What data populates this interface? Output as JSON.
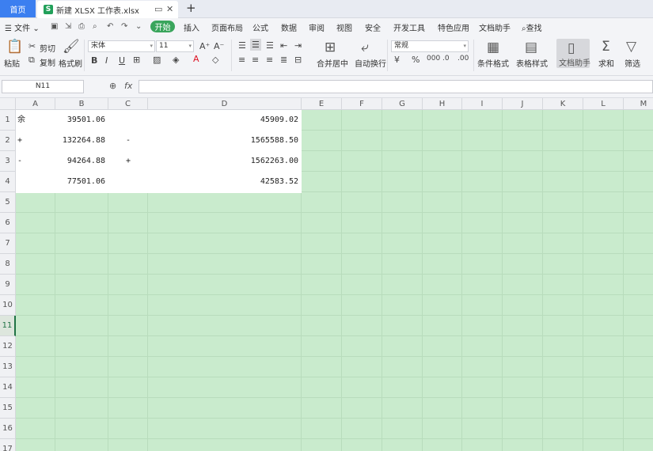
{
  "tabs": {
    "home": "首页",
    "file": "新建 XLSX 工作表.xlsx",
    "new_tab": "+"
  },
  "menu": {
    "file": "文件",
    "items": [
      "开始",
      "插入",
      "页面布局",
      "公式",
      "数据",
      "审阅",
      "视图",
      "安全",
      "开发工具",
      "特色应用",
      "文档助手",
      "查找"
    ]
  },
  "ribbon": {
    "paste": "粘贴",
    "cut": "剪切",
    "copy": "复制",
    "format_painter": "格式刷",
    "font_name": "宋体",
    "font_size": "11",
    "merge_center": "合并居中",
    "wrap_text": "自动换行",
    "number_format": "常规",
    "conditional_format": "条件格式",
    "table_style": "表格样式",
    "doc_assistant": "文档助手",
    "sum": "求和",
    "filter": "筛选"
  },
  "formula": {
    "namebox": "N11",
    "fx": "fx",
    "value": ""
  },
  "columns": [
    "A",
    "B",
    "C",
    "D",
    "E",
    "F",
    "G",
    "H",
    "I",
    "J",
    "K",
    "L",
    "M"
  ],
  "rows": [
    "1",
    "2",
    "3",
    "4",
    "5",
    "6",
    "7",
    "8",
    "9",
    "10",
    "11",
    "12",
    "13",
    "14",
    "15",
    "16",
    "17"
  ],
  "selected_row": "11",
  "cells": [
    {
      "row": 1,
      "A": "余",
      "B": "39501.06",
      "C": "",
      "D": "45909.02"
    },
    {
      "row": 2,
      "A": "+",
      "B": "132264.88",
      "C": "-",
      "D": "1565588.50"
    },
    {
      "row": 3,
      "A": "-",
      "B": "94264.88",
      "C": "+",
      "D": "1562263.00"
    },
    {
      "row": 4,
      "A": "",
      "B": "77501.06",
      "C": "",
      "D": "42583.52"
    }
  ],
  "colors": {
    "accent": "#3c7ff0",
    "start_green": "#3aa55c",
    "sheet_bg": "#c9ebcd",
    "selected_row_color": "#217346"
  }
}
